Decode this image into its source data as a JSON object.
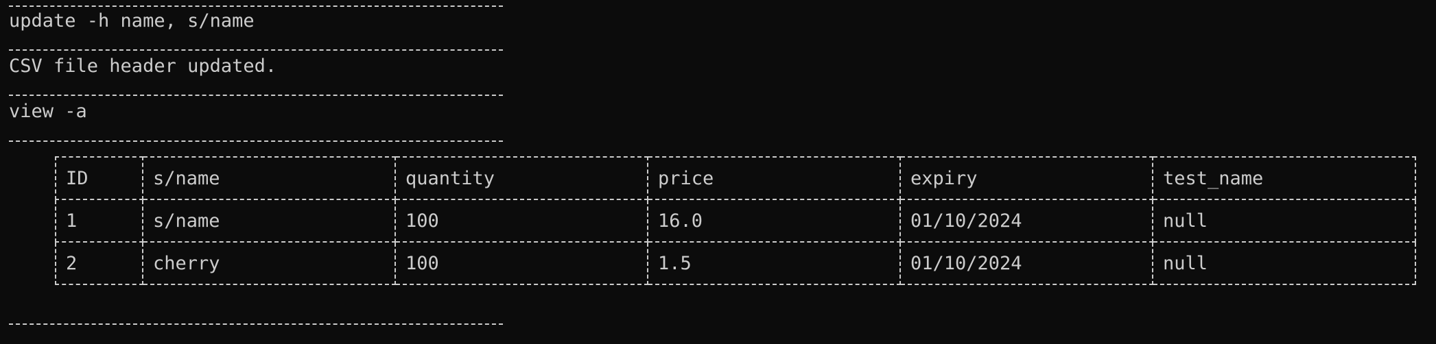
{
  "terminal": {
    "lines": {
      "command1": "update -h name, s/name",
      "output1": "CSV file header updated.",
      "command2": "view -a"
    },
    "table": {
      "headers": [
        "ID",
        "s/name",
        "quantity",
        "price",
        "expiry",
        "test_name"
      ],
      "rows": [
        [
          "1",
          "s/name",
          "100",
          "16.0",
          "01/10/2024",
          "null"
        ],
        [
          "2",
          "cherry",
          "100",
          "1.5",
          "01/10/2024",
          "null"
        ]
      ]
    },
    "colors": {
      "background": "#0c0c0c",
      "foreground": "#cccccc"
    }
  }
}
